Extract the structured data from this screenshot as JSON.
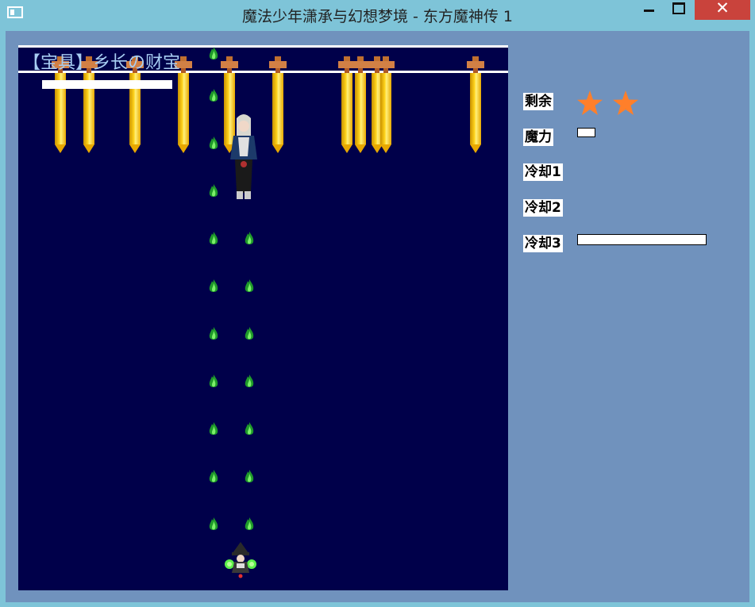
{
  "window": {
    "title": "魔法少年潇承与幻想梦境 - 东方魔神传 1",
    "controls": {
      "minimize": "minimize",
      "maximize": "maximize",
      "close": "✕"
    }
  },
  "playfield": {
    "spell_card_name": "【宝具】乡长の财宝",
    "boss_health": 1.0,
    "sword_count": 11,
    "flame_bullet_rows": 10
  },
  "hud": {
    "lives_label": "剩余",
    "lives_count": 2,
    "mana_label": "魔力",
    "mana_level": 0.14,
    "cooldown1_label": "冷却1",
    "cooldown1_level": 0,
    "cooldown2_label": "冷却2",
    "cooldown2_level": 0,
    "cooldown3_label": "冷却3",
    "cooldown3_level": 1.0
  },
  "colors": {
    "window_frame": "#7ec4d8",
    "client_background": "#7092bd",
    "playfield_background": "#00004a",
    "spell_name_text": "#a7cdf2",
    "sword_blade": "#ffd21a",
    "sword_hilt": "#d28045",
    "bullet_green": "#3cd13c",
    "star_orange": "#ff7f2a",
    "close_button": "#c9433c"
  },
  "icons": {
    "app": "app-window-icon",
    "lives": "star-icon",
    "enemy_bullet": "green-flame-icon",
    "boss_projectile": "golden-sword-icon"
  }
}
